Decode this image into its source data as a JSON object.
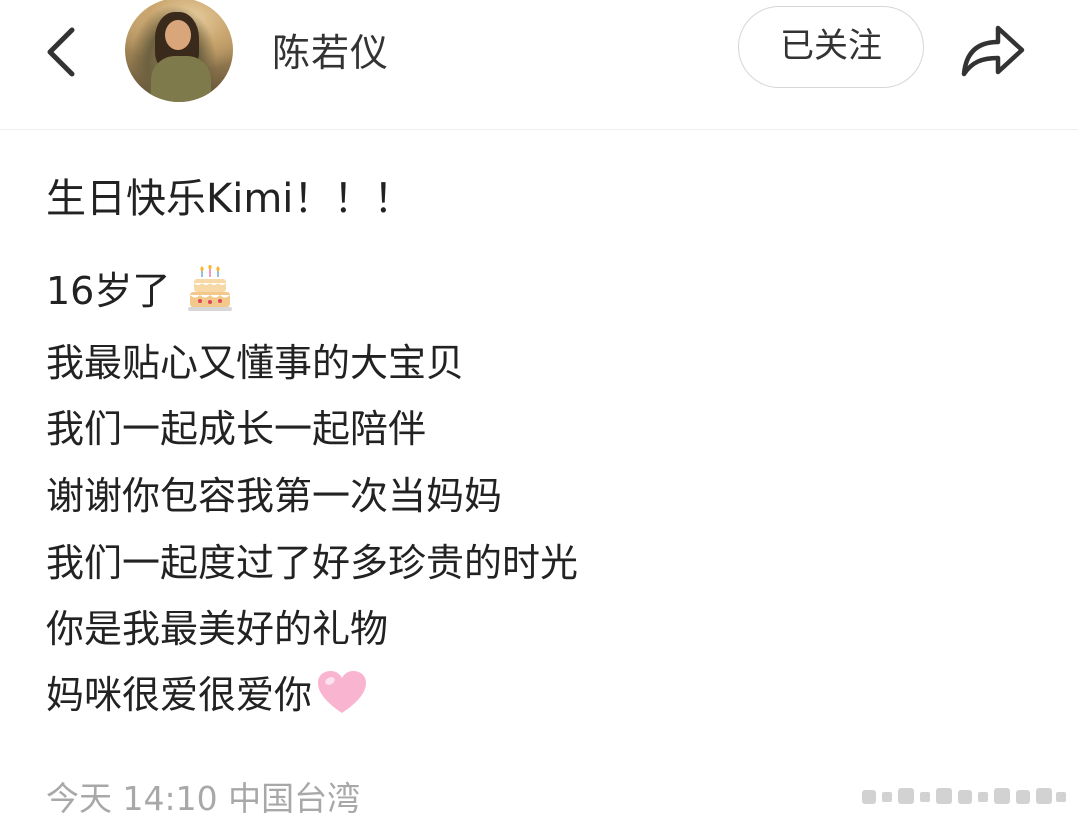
{
  "header": {
    "username": "陈若仪",
    "follow_label": "已关注"
  },
  "icons": {
    "back": "chevron-left-icon",
    "share": "share-arrow-icon",
    "cake": "birthday-cake-emoji",
    "heart": "pink-heart-emoji"
  },
  "post": {
    "title": "生日快乐Kimi！！！",
    "age_line": "16岁了",
    "lines": [
      "我最贴心又懂事的大宝贝",
      "我们一起成长一起陪伴",
      "谢谢你包容我第一次当妈妈",
      "我们一起度过了好多珍贵的时光",
      "你是我最美好的礼物",
      "妈咪很爱很爱你"
    ]
  },
  "meta": {
    "time_location": "今天 14:10 中国台湾"
  },
  "colors": {
    "text": "#222222",
    "meta": "#a8a8a8",
    "border": "#d6d6d6",
    "heart": "#f7a8c8"
  }
}
